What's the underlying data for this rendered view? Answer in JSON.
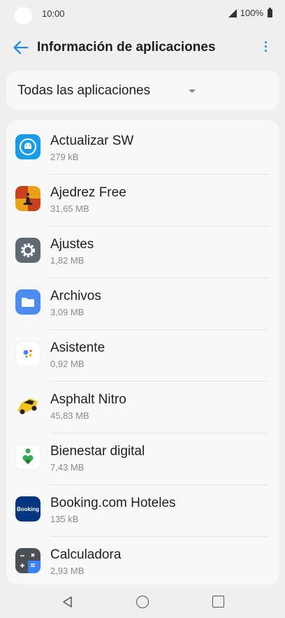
{
  "status_bar": {
    "time": "10:00",
    "battery": "100%"
  },
  "header": {
    "title": "Información de aplicaciones"
  },
  "filter": {
    "label": "Todas las aplicaciones"
  },
  "apps": [
    {
      "name": "Actualizar SW",
      "size": "279 kB",
      "icon": "android-update-icon"
    },
    {
      "name": "Ajedrez Free",
      "size": "31,65 MB",
      "icon": "chess-icon"
    },
    {
      "name": "Ajustes",
      "size": "1,82 MB",
      "icon": "gear-icon"
    },
    {
      "name": "Archivos",
      "size": "3,09 MB",
      "icon": "folder-icon"
    },
    {
      "name": "Asistente",
      "size": "0,92 MB",
      "icon": "assistant-icon"
    },
    {
      "name": "Asphalt Nitro",
      "size": "45,83 MB",
      "icon": "race-car-icon"
    },
    {
      "name": "Bienestar digital",
      "size": "7,43 MB",
      "icon": "wellbeing-icon"
    },
    {
      "name": "Booking.com Hoteles",
      "size": "135 kB",
      "icon": "booking-icon",
      "icon_text": "Booking"
    },
    {
      "name": "Calculadora",
      "size": "2,93 MB",
      "icon": "calculator-icon"
    }
  ],
  "colors": {
    "accent": "#1e88e5",
    "background": "#efefef",
    "card": "#f8f8f8"
  }
}
